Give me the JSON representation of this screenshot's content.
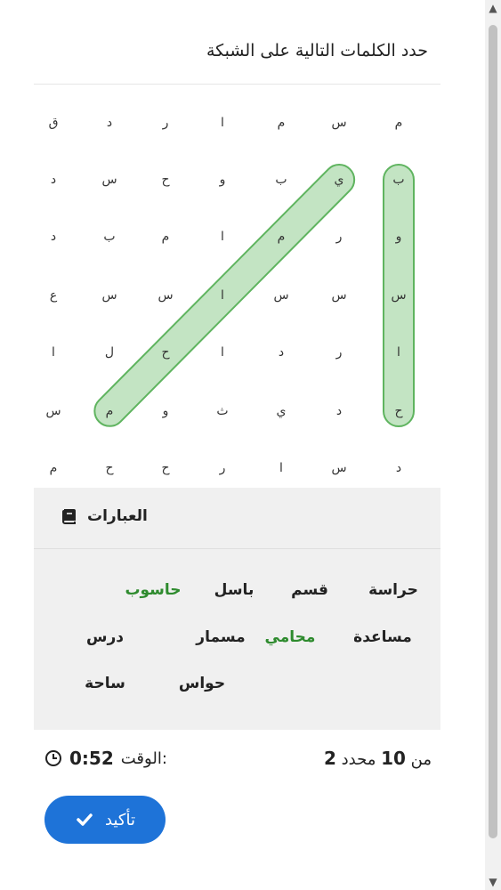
{
  "title": "حدد الكلمات التالية على الشبكة",
  "grid": [
    [
      "ق",
      "ﺩ",
      "ﺭ",
      "ا",
      "ﻡ",
      "ﺱ",
      "ﻡ"
    ],
    [
      "ﺩ",
      "ﺱ",
      "ح",
      "ﻭ",
      "ب",
      "ي",
      "ب"
    ],
    [
      "ﺩ",
      "ب",
      "ﻡ",
      "ا",
      "ﻡ",
      "ﺭ",
      "ﻭ"
    ],
    [
      "ع",
      "ﺱ",
      "ﺱ",
      "ا",
      "ﺱ",
      "ﺱ",
      "ﺱ"
    ],
    [
      "ا",
      "ل",
      "ح",
      "ا",
      "ﺩ",
      "ﺭ",
      "ا"
    ],
    [
      "ﺱ",
      "ﻡ",
      "ﻭ",
      "ث",
      "ي",
      "ﺩ",
      "ح"
    ],
    [
      "ﻡ",
      "ح",
      "ح",
      "ﺭ",
      "ا",
      "ﺱ",
      "ﺩ"
    ]
  ],
  "phrases": {
    "heading": "العبارات",
    "words": [
      {
        "text": "حراسة",
        "found": false
      },
      {
        "text": "قسم",
        "found": false
      },
      {
        "text": "باسل",
        "found": false
      },
      {
        "text": "حاسوب",
        "found": true
      },
      {
        "text": "مساعدة",
        "found": false
      },
      {
        "text": "محامي",
        "found": true
      },
      {
        "text": "مسمار",
        "found": false
      },
      {
        "text": "درس",
        "found": false
      },
      {
        "text": "حواس",
        "found": false
      },
      {
        "text": "ساحة",
        "found": false
      }
    ]
  },
  "progress": {
    "found": "2",
    "found_label": "محدد",
    "of_label": "من",
    "total": "10"
  },
  "timer": {
    "label": "الوقت:",
    "value": "0:52"
  },
  "confirm_button": {
    "label": "تأكيد"
  },
  "colors": {
    "accent": "#1e73d8",
    "found": "#2e8b2e",
    "highlight": "#79c479"
  },
  "icons": {
    "phrases": "book-icon",
    "timer": "clock-icon",
    "confirm": "check-icon"
  }
}
